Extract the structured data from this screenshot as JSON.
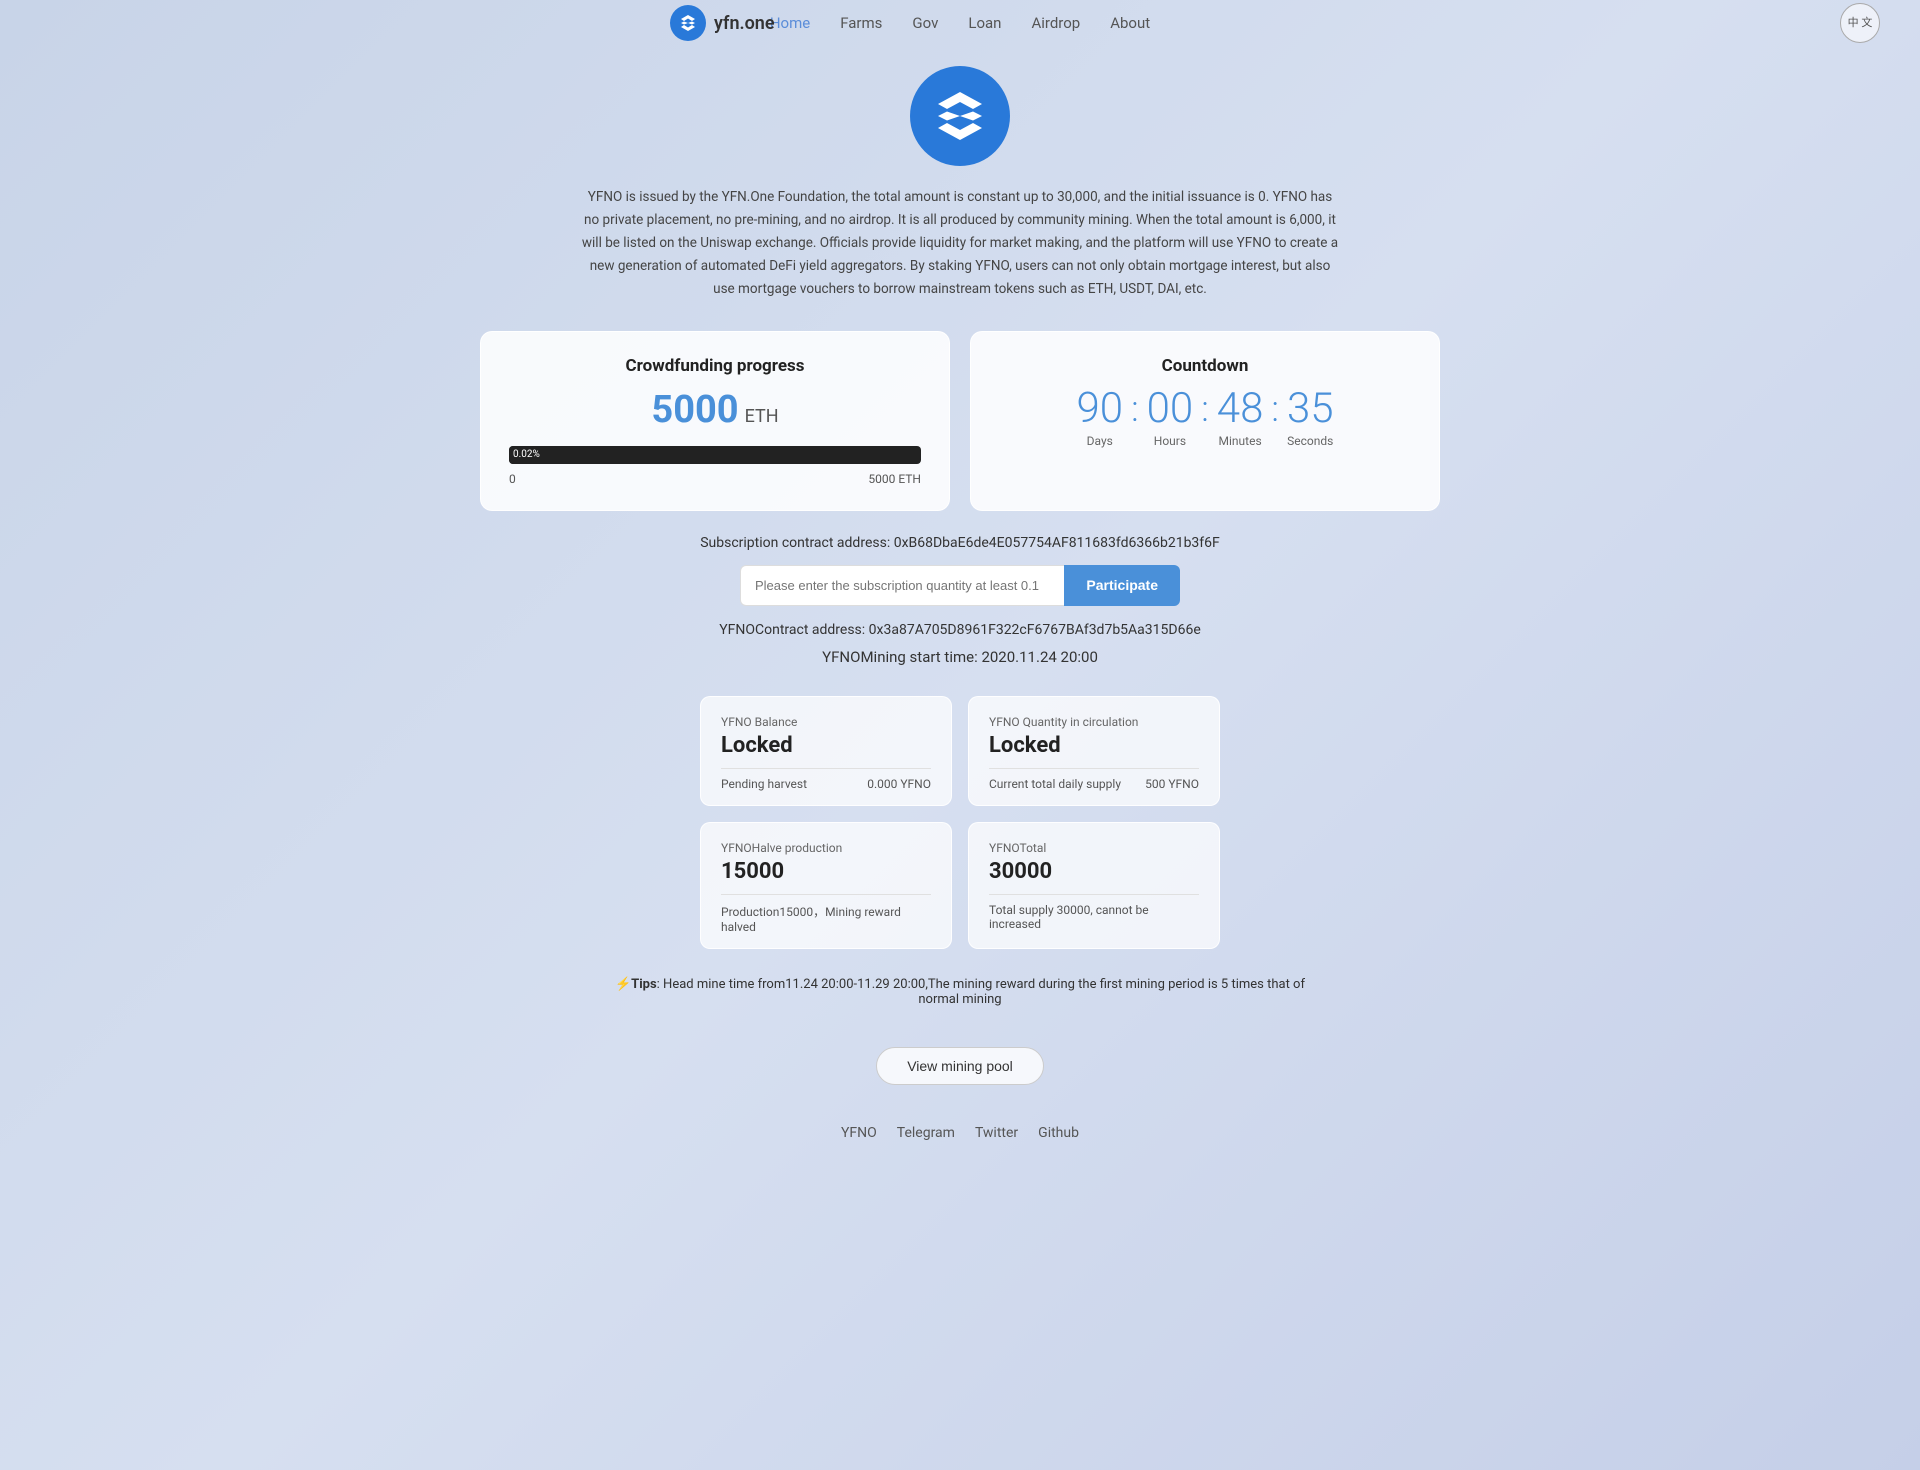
{
  "nav": {
    "logo_text": "yfn.one",
    "links": [
      {
        "label": "Home",
        "active": true
      },
      {
        "label": "Farms",
        "active": false
      },
      {
        "label": "Gov",
        "active": false
      },
      {
        "label": "Loan",
        "active": false
      },
      {
        "label": "Airdrop",
        "active": false
      },
      {
        "label": "About",
        "active": false
      }
    ],
    "lang_btn": "中\n文"
  },
  "description": "YFNO is issued by the YFN.One Foundation, the total amount is constant up to 30,000, and the initial issuance is 0. YFNO has no private placement, no pre-mining, and no airdrop. It is all produced by community mining. When the total amount is 6,000, it will be listed on the Uniswap exchange. Officials provide liquidity for market making, and the platform will use YFNO to create a new generation of automated DeFi yield aggregators. By staking YFNO, users can not only obtain mortgage interest, but also use mortgage vouchers to borrow mainstream tokens such as ETH, USDT, DAI, etc.",
  "crowdfunding": {
    "title": "Crowdfunding progress",
    "amount": "5000",
    "unit": "ETH",
    "progress_pct": 0.02,
    "progress_label": "0.02%",
    "range_min": "0",
    "range_max": "5000 ETH"
  },
  "countdown": {
    "title": "Countdown",
    "days": "90",
    "hours": "00",
    "minutes": "48",
    "seconds": "35",
    "days_label": "Days",
    "hours_label": "Hours",
    "minutes_label": "Minutes",
    "seconds_label": "Seconds"
  },
  "subscription": {
    "contract_label": "Subscription contract address:",
    "contract_address": "0xB68DbaE6de4E057754AF811683fd6366b21b3f6F",
    "input_placeholder": "Please enter the subscription quantity at least 0.1",
    "participate_btn": "Participate"
  },
  "yfno": {
    "contract_label": "YFNOContract address:",
    "contract_address": "0x3a87A705D8961F322cF6767BAf3d7b5Aa315D66e",
    "mining_time_label": "YFNOMining start time: 2020.11.24 20:00"
  },
  "info_cards": [
    {
      "label": "YFNO Balance",
      "value": "Locked",
      "sub_label": "Pending harvest",
      "sub_value": "0.000  YFNO"
    },
    {
      "label": "YFNO Quantity in circulation",
      "value": "Locked",
      "sub_label": "Current total daily supply",
      "sub_value": "500  YFNO"
    },
    {
      "label": "YFNOHalve production",
      "value": "15000",
      "sub_label": "Production15000，Mining reward halved",
      "sub_value": ""
    },
    {
      "label": "YFNOTotal",
      "value": "30000",
      "sub_label": "Total supply 30000, cannot be increased",
      "sub_value": ""
    }
  ],
  "tips": {
    "prefix": "⚡Tips",
    "text": ": Head mine time from11.24 20:00-11.29 20:00,The mining reward during the first mining period is 5 times that of normal mining"
  },
  "view_mining_btn": "View mining pool",
  "footer": {
    "links": [
      "YFNO",
      "Telegram",
      "Twitter",
      "Github"
    ]
  }
}
